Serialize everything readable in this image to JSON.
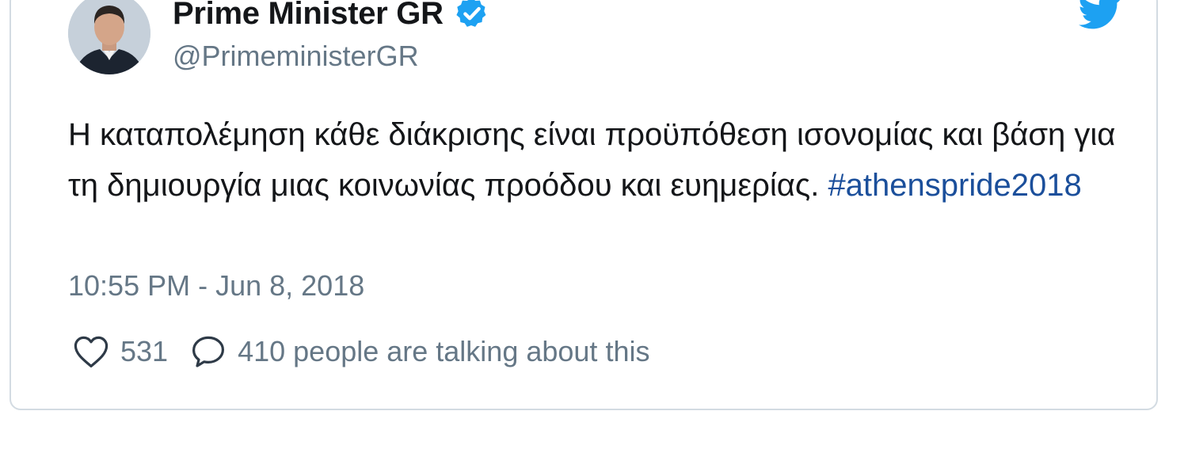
{
  "tweet": {
    "display_name": "Prime Minister GR",
    "handle": "@PrimeministerGR",
    "text": "Η καταπολέμηση κάθε διάκρισης είναι προϋπόθεση ισονομίας και βάση για τη δημιουργία μιας κοινωνίας προόδου και ευημερίας.",
    "hashtag": "#athenspride2018",
    "timestamp": "10:55 PM - Jun 8, 2018",
    "likes": "531",
    "talking": "410 people are talking about this"
  },
  "icons": {
    "avatar": "profile-photo",
    "verified": "verified-badge-icon",
    "brand": "twitter-bird-icon",
    "like": "heart-icon",
    "reply": "speech-bubble-icon"
  },
  "colors": {
    "brand_blue": "#1da1f2",
    "hashtag": "#1b4f9b",
    "text": "#141619",
    "muted": "#657786",
    "border": "#d3dbe2"
  }
}
